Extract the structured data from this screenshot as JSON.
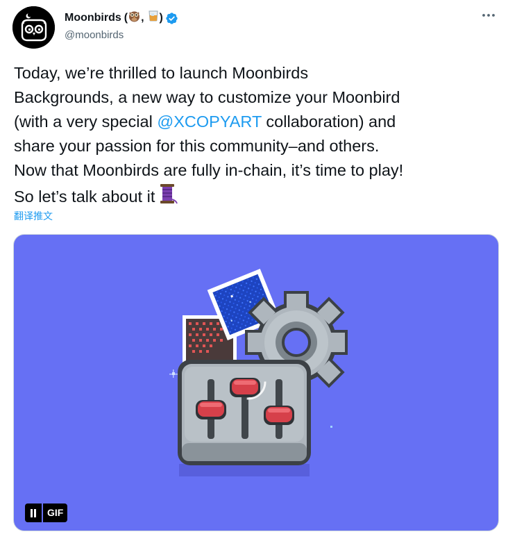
{
  "author": {
    "name": "Moonbirds",
    "name_open": "(",
    "name_sep": ",",
    "name_close": ")",
    "name_emoji_1": "owl-emoji",
    "name_emoji_2": "whisky-glass-emoji",
    "verified_icon": "verified-badge-icon",
    "handle": "@moonbirds",
    "avatar_icon": "moonbird-owl-avatar"
  },
  "more_menu": {
    "icon": "more-horizontal-icon",
    "label": "···"
  },
  "tweet": {
    "line1": "Today, we’re thrilled to launch Moonbirds",
    "line2": "Backgrounds, a new way to customize your Moonbird",
    "line3_before": "(with a very special ",
    "mention": "@XCOPYART",
    "line3_after": " collaboration) and",
    "line4": "share your passion for this community–and others.",
    "line5": "Now that Moonbirds are fully in-chain, it’s time to play!",
    "line6": "So let’s talk about it",
    "thread_icon": "thread-spool-icon"
  },
  "translate_link": "翻译推文",
  "media": {
    "type": "GIF",
    "badge": "GIF",
    "pause_icon": "pause-icon",
    "background_color": "#6670f4",
    "illustration": "settings-sliders-gear-pixel-art"
  },
  "colors": {
    "link": "#1d9bf0",
    "text": "#0f1419",
    "secondary": "#536471"
  }
}
